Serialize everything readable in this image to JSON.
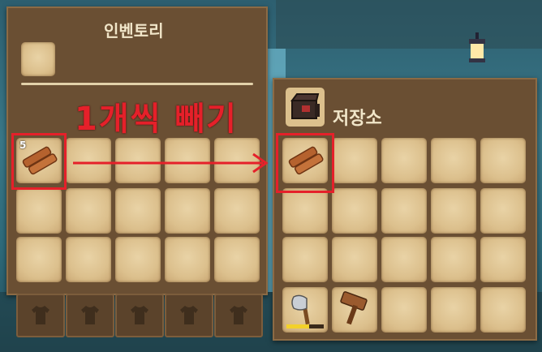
{
  "inventory": {
    "title": "인벤토리",
    "first_slot_count": "5"
  },
  "annotation": {
    "text": "1개씩 빼기",
    "color": "#e5202a"
  },
  "storage": {
    "title": "저장소",
    "axe_durability": 0.6
  },
  "icons": [
    "wood-plank-icon",
    "storage-chest-icon",
    "axe-icon",
    "hammer-icon",
    "shirt-icon",
    "lantern-icon"
  ],
  "colors": {
    "panel": "#6a4f33",
    "slot": "#dcc08d",
    "title_text": "#f1e6c9",
    "highlight": "#e5202a"
  }
}
